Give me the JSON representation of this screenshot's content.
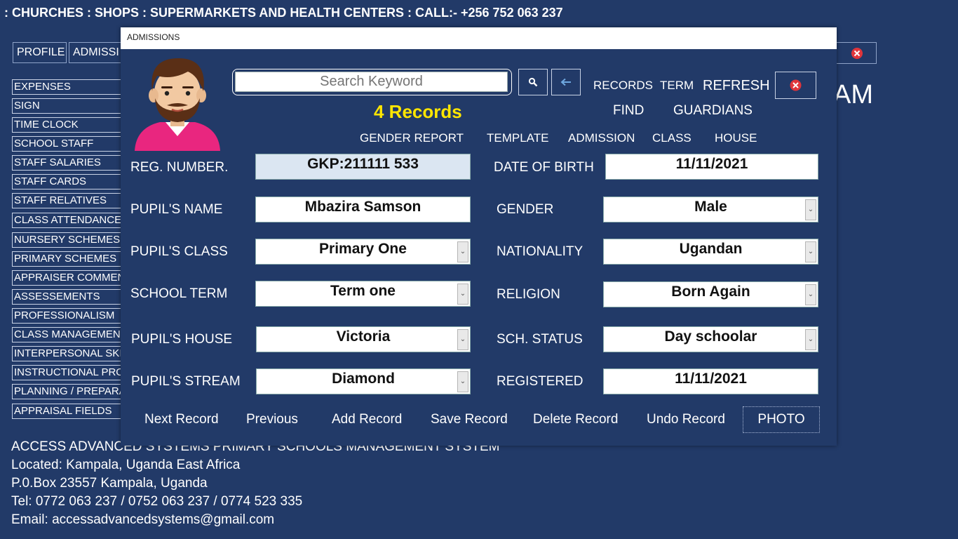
{
  "marquee": ": CHURCHES : SHOPS : SUPERMARKETS AND HEALTH CENTERS : CALL:- +256 752 063 237",
  "top_nav": {
    "profile": "PROFILE",
    "admissions": "ADMISSI"
  },
  "background_heading_tail": "AM",
  "sidebar": {
    "items": [
      {
        "label": "EXPENSES"
      },
      {
        "label": "SIGN"
      },
      {
        "label": "TIME CLOCK"
      },
      {
        "label": "SCHOOL STAFF"
      },
      {
        "label": "STAFF SALARIES"
      },
      {
        "label": "STAFF CARDS"
      },
      {
        "label": "STAFF RELATIVES"
      },
      {
        "label": "CLASS ATTENDANCE"
      },
      {
        "label": "NURSERY SCHEMES"
      },
      {
        "label": "PRIMARY SCHEMES"
      },
      {
        "label": "APPRAISER COMMENT"
      },
      {
        "label": "ASSESSEMENTS"
      },
      {
        "label": "PROFESSIONALISM"
      },
      {
        "label": "CLASS MANAGEMENT"
      },
      {
        "label": "INTERPERSONAL SKILL"
      },
      {
        "label": "INSTRUCTIONAL PROC"
      },
      {
        "label": "PLANNING / PREPARAT"
      },
      {
        "label": "APPRAISAL FIELDS"
      }
    ]
  },
  "footer": {
    "line1": "ACCESS ADVANCED SYSTEMS PRIMARY SCHOOLS MANAGEMENT SYSTEM",
    "line2": "Located: Kampala, Uganda East Africa",
    "line3": "P.0.Box 23557 Kampala, Uganda",
    "line4": "Tel: 0772 063 237 / 0752 063 237 / 0774 523 335",
    "line5": "Email: accessadvancedsystems@gmail.com"
  },
  "dialog": {
    "title": "ADMISSIONS",
    "search_placeholder": "Search Keyword",
    "records_count": "4 Records",
    "links": {
      "records": "RECORDS",
      "term": "TERM",
      "refresh": "REFRESH",
      "find": "FIND",
      "guardians": "GUARDIANS",
      "gender_report": "GENDER REPORT",
      "template": "TEMPLATE",
      "admission": "ADMISSION",
      "class": "CLASS",
      "house": "HOUSE"
    },
    "fields": {
      "reg_number": {
        "label": "REG. NUMBER.",
        "value": "GKP:211111 533"
      },
      "pupil_name": {
        "label": "PUPIL'S NAME",
        "value": "Mbazira Samson"
      },
      "pupil_class": {
        "label": "PUPIL'S  CLASS",
        "value": "Primary One"
      },
      "school_term": {
        "label": "SCHOOL TERM",
        "value": "Term one"
      },
      "pupil_house": {
        "label": "PUPIL'S  HOUSE",
        "value": "Victoria"
      },
      "pupil_stream": {
        "label": "PUPIL'S  STREAM",
        "value": "Diamond"
      },
      "date_of_birth": {
        "label": "DATE OF BIRTH",
        "value": "11/11/2021"
      },
      "gender": {
        "label": "GENDER",
        "value": "Male"
      },
      "nationality": {
        "label": "NATIONALITY",
        "value": "Ugandan"
      },
      "religion": {
        "label": "RELIGION",
        "value": "Born Again"
      },
      "sch_status": {
        "label": "SCH. STATUS",
        "value": "Day schoolar"
      },
      "registered": {
        "label": "REGISTERED",
        "value": "11/11/2021"
      }
    },
    "buttons": {
      "next": "Next Record",
      "previous": "Previous",
      "add": "Add Record",
      "save": "Save Record",
      "delete": "Delete Record",
      "undo": "Undo Record",
      "photo": "PHOTO"
    },
    "icons": {
      "search": "search-icon",
      "back": "back-arrow-icon",
      "close": "close-icon",
      "avatar": "avatar-icon"
    }
  },
  "colors": {
    "background": "#223a68",
    "records_count": "#ffe600",
    "close_red": "#e0353b",
    "avatar_shirt": "#e9267f"
  }
}
